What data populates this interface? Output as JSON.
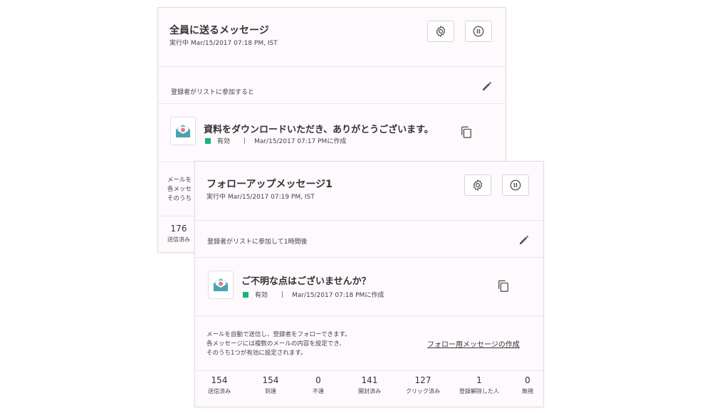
{
  "back_card": {
    "title": "全員に送るメッセージ",
    "status_line": "実行中 Mar/15/2017 07:18 PM, IST",
    "trigger": "登録者がリストに参加すると",
    "message": {
      "subject": "資料をダウンロードいただき、ありがとうございます。",
      "status": "有効",
      "created": "Mar/15/2017 07:17 PMに作成"
    },
    "description_lines": [
      "メールを",
      "各メッセ",
      "そのうち"
    ],
    "stats": [
      {
        "value": "176",
        "label": "送信済み"
      }
    ]
  },
  "front_card": {
    "title": "フォローアップメッセージ1",
    "status_line": "実行中 Mar/15/2017 07:19 PM, IST",
    "trigger": "登録者がリストに参加して1時間後",
    "message": {
      "subject": "ご不明な点はございませんか？",
      "status": "有効",
      "created": "Mar/15/2017 07:18 PMに作成"
    },
    "description_lines": [
      "メールを自動で送信し、登録者をフォローできます。",
      "各メッセージには複数のメールの内容を設定でき、",
      "そのうち1つが有効に設定されます。"
    ],
    "follow_link": "フォロー用メッセージの作成",
    "stats": [
      {
        "value": "154",
        "label": "送信済み"
      },
      {
        "value": "154",
        "label": "到達"
      },
      {
        "value": "0",
        "label": "不達"
      },
      {
        "value": "141",
        "label": "開封済み"
      },
      {
        "value": "127",
        "label": "クリック済み"
      },
      {
        "value": "1",
        "label": "登録解除した人"
      },
      {
        "value": "0",
        "label": "無視"
      }
    ]
  },
  "icons": {
    "settings": "gear-icon",
    "pause": "pause-icon",
    "edit": "pencil-icon",
    "copy": "copy-icon",
    "envelope": "open-envelope-icon"
  },
  "colors": {
    "active_status": "#19b37b",
    "card_background": "#fdf9fd",
    "envelope_teal": "#5bb7c4"
  }
}
